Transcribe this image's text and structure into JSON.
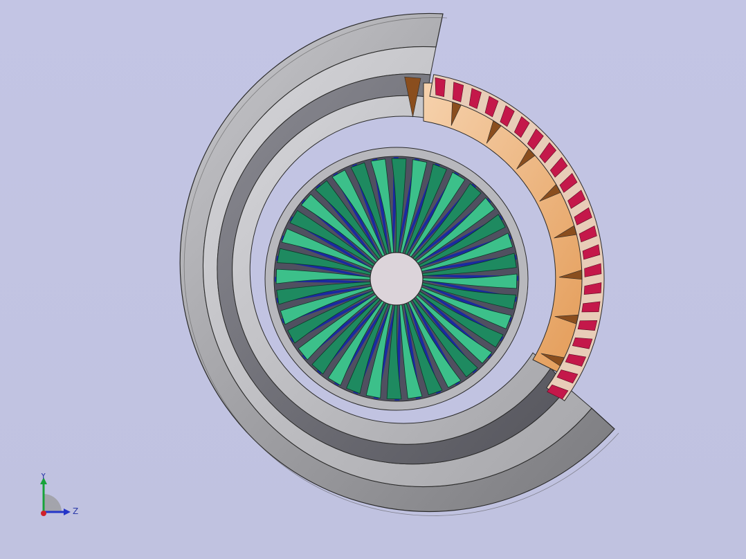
{
  "scene": {
    "type": "cad-3d-viewport",
    "subject": "turbine-assembly-section-view",
    "colors": {
      "background": "#c2c4e2",
      "casing": "#9e9e9e",
      "casing_dark": "#6e6e72",
      "casing_light": "#c8c8cc",
      "blades": "#1e8a60",
      "blade_highlight": "#3cc08a",
      "back_blades": "#1a2aa0",
      "hub": "#d9d2d8",
      "stator_vanes": "#e7a866",
      "stator_light": "#f3c79a",
      "outer_blades": "#c4184a",
      "edge": "#2a2a2a"
    },
    "blade_count": 36,
    "stator_vane_count": 9,
    "outer_blade_count": 22
  },
  "triad": {
    "y_label": "Y",
    "z_label": "Z",
    "icons": [
      "y-axis-arrow-icon",
      "z-axis-arrow-icon",
      "x-axis-origin-icon"
    ]
  }
}
